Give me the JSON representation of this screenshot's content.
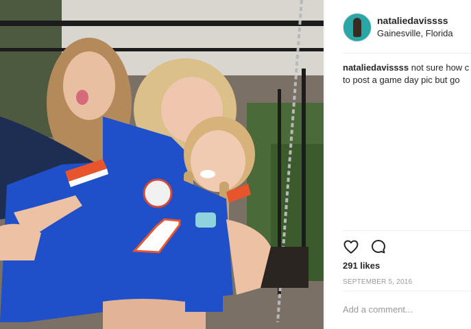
{
  "post": {
    "username": "nataliedavissss",
    "location": "Gainesville, Florida",
    "caption_user": "nataliedavissss",
    "caption_line1": "not sure how c",
    "caption_line2": "to post a game day pic but go",
    "likes": "291 likes",
    "date": "SEPTEMBER 5, 2016",
    "comment_placeholder": "Add a comment...",
    "jersey_number": "1"
  },
  "icons": {
    "like": "heart-icon",
    "comment": "speech-bubble-icon"
  },
  "colors": {
    "jersey_blue": "#1f4fc9",
    "jersey_orange": "#e8542b",
    "text": "#262626",
    "muted": "#999999",
    "divider": "#efefef"
  }
}
